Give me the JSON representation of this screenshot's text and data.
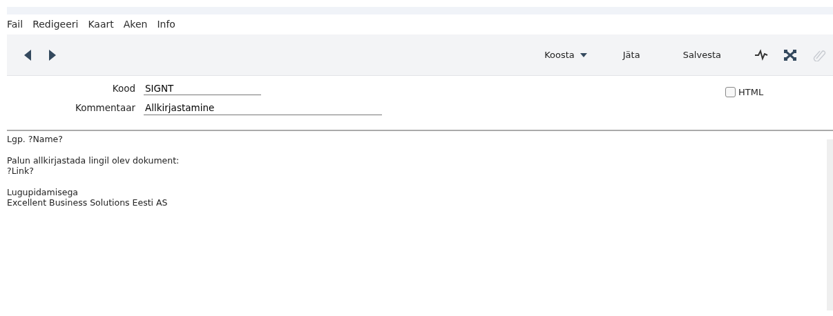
{
  "menu": [
    "Fail",
    "Redigeeri",
    "Kaart",
    "Aken",
    "Info"
  ],
  "toolbar": {
    "buttons": [
      {
        "label": "Koosta",
        "kind": "dropdown"
      },
      {
        "label": "Jäta",
        "kind": "plain"
      },
      {
        "label": "Salvesta",
        "kind": "plain"
      }
    ],
    "tools": [
      {
        "kind": "activity",
        "disabled": false
      },
      {
        "kind": "expand",
        "disabled": false
      },
      {
        "kind": "attach",
        "disabled": true
      }
    ]
  },
  "form": {
    "fields": [
      {
        "label": "Kood",
        "value": "SIGNT",
        "kind": "short"
      },
      {
        "label": "Kommentaar",
        "value": "Allkirjastamine",
        "kind": "long"
      }
    ],
    "html_checkbox": {
      "label": "HTML",
      "checked": false
    }
  },
  "body": [
    [
      "Lgp. ?Name?"
    ],
    [
      "Palun allkirjastada lingil olev dokument:",
      "?Link?"
    ],
    [
      "Lugupidamisega",
      "Excellent Business Solutions Eesti AS"
    ]
  ]
}
